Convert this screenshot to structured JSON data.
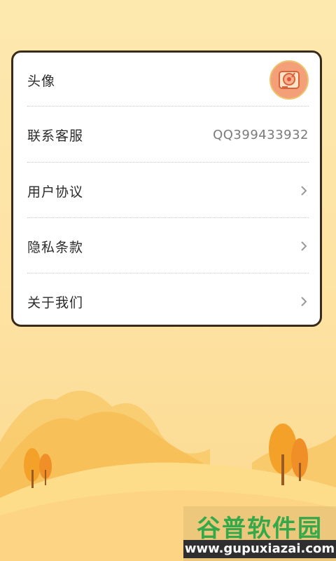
{
  "settings": {
    "items": [
      {
        "label": "头像",
        "kind": "avatar",
        "icon": "record-player-avatar-icon"
      },
      {
        "label": "联系客服",
        "kind": "value",
        "value": "QQ399433932"
      },
      {
        "label": "用户协议",
        "kind": "chevron",
        "icon": "chevron-right-icon"
      },
      {
        "label": "隐私条款",
        "kind": "chevron",
        "icon": "chevron-right-icon"
      },
      {
        "label": "关于我们",
        "kind": "chevron",
        "icon": "chevron-right-icon"
      }
    ]
  },
  "watermark": {
    "title": "谷普软件园",
    "url": "www.gupuxiazai.com"
  },
  "colors": {
    "background": "#fde3a4",
    "card_border": "#3a2a18",
    "avatar_bg": "#f3a078",
    "watermark_green": "#35a84a"
  }
}
